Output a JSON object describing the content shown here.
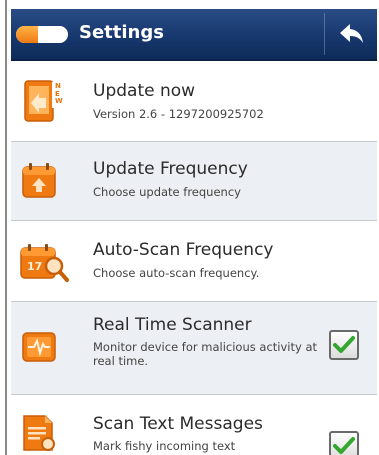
{
  "header": {
    "title": "Settings"
  },
  "colors": {
    "titlebar": "#17386e",
    "accent_orange": "#f07a12",
    "check_green": "#35a62f"
  },
  "icons": {
    "app_toggle": "toggle-pill-icon",
    "back": "back-arrow-icon"
  },
  "settings": {
    "items": [
      {
        "title": "Update now",
        "subtitle": "Version 2.6 - 1297200925702",
        "icon": "update-now-icon",
        "badge": "NEW"
      },
      {
        "title": "Update Frequency",
        "subtitle": "Choose update frequency",
        "icon": "calendar-update-icon"
      },
      {
        "title": "Auto-Scan Frequency",
        "subtitle": "Choose auto-scan frequency.",
        "icon": "calendar-scan-icon",
        "badge": "17"
      },
      {
        "title": "Real Time Scanner",
        "subtitle": "Monitor device for malicious activity at real time.",
        "icon": "pulse-monitor-icon",
        "checked": true
      },
      {
        "title": "Scan Text Messages",
        "subtitle": "Mark fishy incoming text",
        "icon": "message-scan-icon",
        "checked": true
      }
    ]
  }
}
